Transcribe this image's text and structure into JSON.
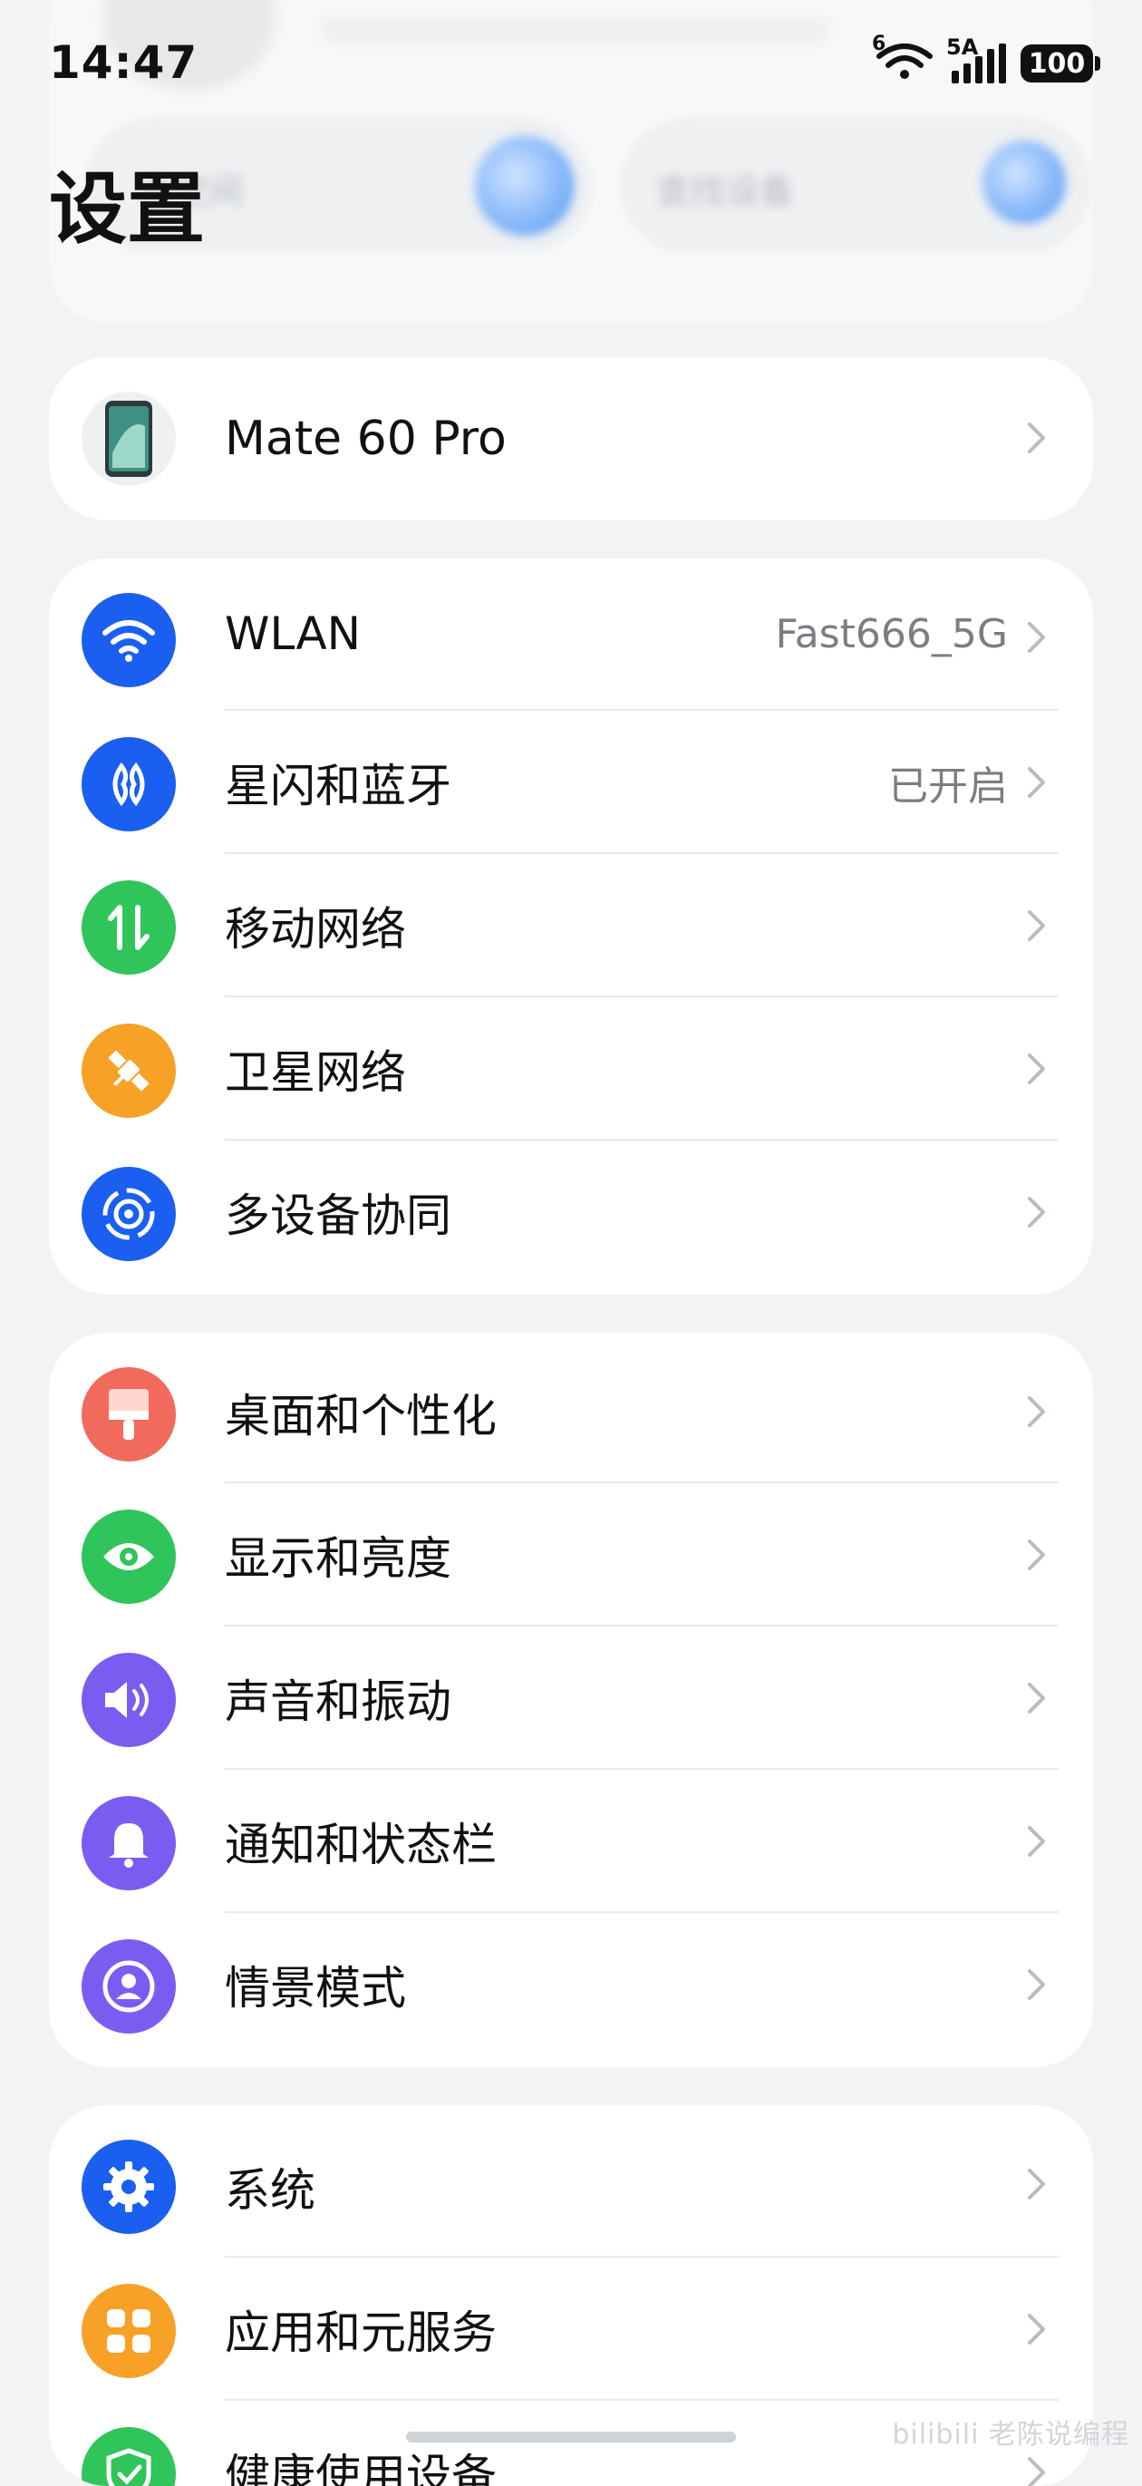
{
  "status_bar": {
    "time": "14:47",
    "signal_tag": "5A",
    "wifi_tag": "6",
    "battery": "100"
  },
  "page_title": "设置",
  "background_card": {
    "left_pill": "云空间",
    "right_pill": "查找设备"
  },
  "device": {
    "name": "Mate 60 Pro"
  },
  "group1": [
    {
      "label": "WLAN",
      "value": "Fast666_5G",
      "icon": "wifi-icon",
      "color": "#1a5ff0"
    },
    {
      "label": "星闪和蓝牙",
      "value": "已开启",
      "icon": "bluetooth-icon",
      "color": "#1a5ff0"
    },
    {
      "label": "移动网络",
      "value": "",
      "icon": "mobile-data-icon",
      "color": "#2fc55a"
    },
    {
      "label": "卫星网络",
      "value": "",
      "icon": "satellite-icon",
      "color": "#f8a127"
    },
    {
      "label": "多设备协同",
      "value": "",
      "icon": "multi-device-icon",
      "color": "#1a5ff0"
    }
  ],
  "group2": [
    {
      "label": "桌面和个性化",
      "icon": "brush-icon",
      "color": "#f16a5b"
    },
    {
      "label": "显示和亮度",
      "icon": "eye-icon",
      "color": "#2fc55a"
    },
    {
      "label": "声音和振动",
      "icon": "speaker-icon",
      "color": "#7a5df0"
    },
    {
      "label": "通知和状态栏",
      "icon": "bell-icon",
      "color": "#7a5df0"
    },
    {
      "label": "情景模式",
      "icon": "profile-icon",
      "color": "#7a5df0"
    }
  ],
  "group3": [
    {
      "label": "系统",
      "icon": "gear-icon",
      "color": "#1a5ff0"
    },
    {
      "label": "应用和元服务",
      "icon": "apps-icon",
      "color": "#f8a127"
    },
    {
      "label": "健康使用设备",
      "icon": "shield-icon",
      "color": "#2fc55a"
    }
  ],
  "watermark": "bilibili 老陈说编程"
}
